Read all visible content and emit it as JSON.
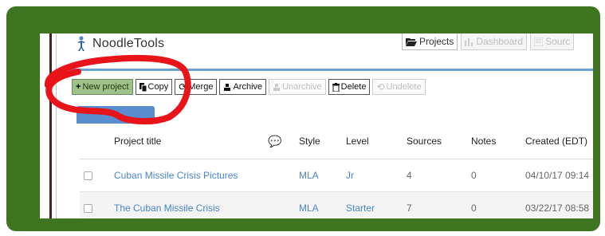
{
  "header": {
    "app_title": "NoodleTools",
    "tabs": [
      {
        "label": "Projects",
        "icon": "folder-open-icon",
        "active": true
      },
      {
        "label": "Dashboard",
        "icon": "bar-chart-icon",
        "active": false
      },
      {
        "label": "Sourc",
        "icon": "list-icon",
        "active": false
      }
    ]
  },
  "toolbar": {
    "new_project": "New project",
    "copy": "Copy",
    "merge": "Merge",
    "archive": "Archive",
    "unarchive": "Unarchive",
    "delete": "Delete",
    "undelete": "Undelete"
  },
  "table": {
    "columns": [
      "Project title",
      "Style",
      "Level",
      "Sources",
      "Notes",
      "Created (EDT)"
    ],
    "rows": [
      {
        "title": "Cuban Missile Crisis Pictures",
        "style": "MLA",
        "level": "Jr",
        "sources": "4",
        "notes": "0",
        "created": "04/10/17 09:14"
      },
      {
        "title": "The Cuban Missile Crisis",
        "style": "MLA",
        "level": "Starter",
        "sources": "7",
        "notes": "0",
        "created": "03/22/17 08:58"
      }
    ]
  },
  "colors": {
    "frame": "#3f7421",
    "annotation": "#e8141a",
    "accent": "#5a8cd0",
    "new_button": "#9fc28b"
  }
}
